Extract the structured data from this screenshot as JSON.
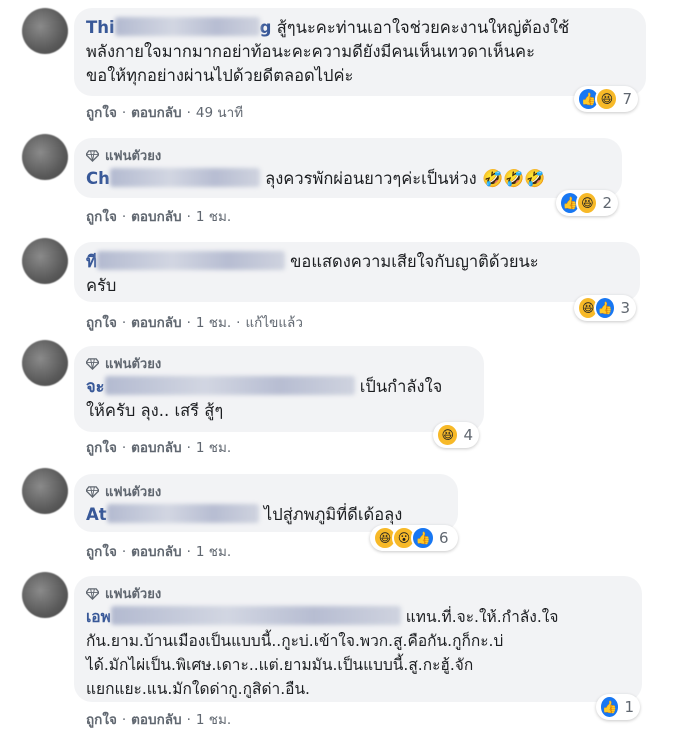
{
  "fan_label": "แฟนตัวยง",
  "actions": {
    "like": "ถูกใจ",
    "reply": "ตอบกลับ",
    "edited": "แก้ไขแล้ว"
  },
  "comments": [
    {
      "name_prefix": "Thi",
      "name_suffix": "g",
      "text": "สู้ๆนะคะท่านเอาใจช่วยคะงานใหญ่ต้องใช้พลังกายใจมากมากอย่าท้อนะคะความดียังมีคนเห็นเทวดาเห็นคะขอให้ทุกอย่างผ่านไปด้วยดีตลอดไปค่ะ",
      "line1": "สู้ๆนะคะท่านเอาใจช่วยคะงานใหญ่ต้องใช้",
      "line2": "พลังกายใจมากมากอย่าท้อนะคะความดียังมีคนเห็นเทวดาเห็นคะ",
      "line3": "ขอให้ทุกอย่างผ่านไปด้วยดีตลอดไปค่ะ",
      "time": "49 นาที",
      "reaction_count": "7"
    },
    {
      "name_prefix": "Ch",
      "text": "ลุงควรพักผ่อนยาวๆค่ะเป็นห่วง",
      "emojis": "🤣🤣🤣",
      "time": "1 ชม.",
      "reaction_count": "2"
    },
    {
      "name_prefix": "ที",
      "text_line1": "ขอแสดงความเสียใจกับญาติด้วยนะ",
      "text_line2": "ครับ",
      "time": "1 ชม.",
      "reaction_count": "3"
    },
    {
      "name_prefix": "จะ",
      "text_line1": "เป็นกำลังใจ",
      "text_line2": "ให้ครับ ลุง.. เสรี สู้ๆ",
      "time": "1 ชม.",
      "reaction_count": "4"
    },
    {
      "name_prefix": "At",
      "text": "ไปสู่ภพภูมิที่ดีเด้อลุง",
      "time": "1 ชม.",
      "reaction_count": "6"
    },
    {
      "name_prefix": "เอพ",
      "line1": "แทน.ที่.จะ.ให้.กำลัง.ใจ",
      "line2": "กัน.ยาม.บ้านเมืองเป็นแบบนี้..กูะบ่.เข้าใจ.พวก.สู.คือกัน.กูก็กะ.บ่",
      "line3": "ได้.มักไผ่เป็น.พิเศษ.เดาะ..แต่.ยามมัน.เป็นแบบนี้.สู.กะฮู้.จัก",
      "line4": "แยกแยะ.แน.มักใดด่ากู.กูสิด่า.อืน.",
      "time": "1 ชม.",
      "reaction_count": "1"
    }
  ]
}
